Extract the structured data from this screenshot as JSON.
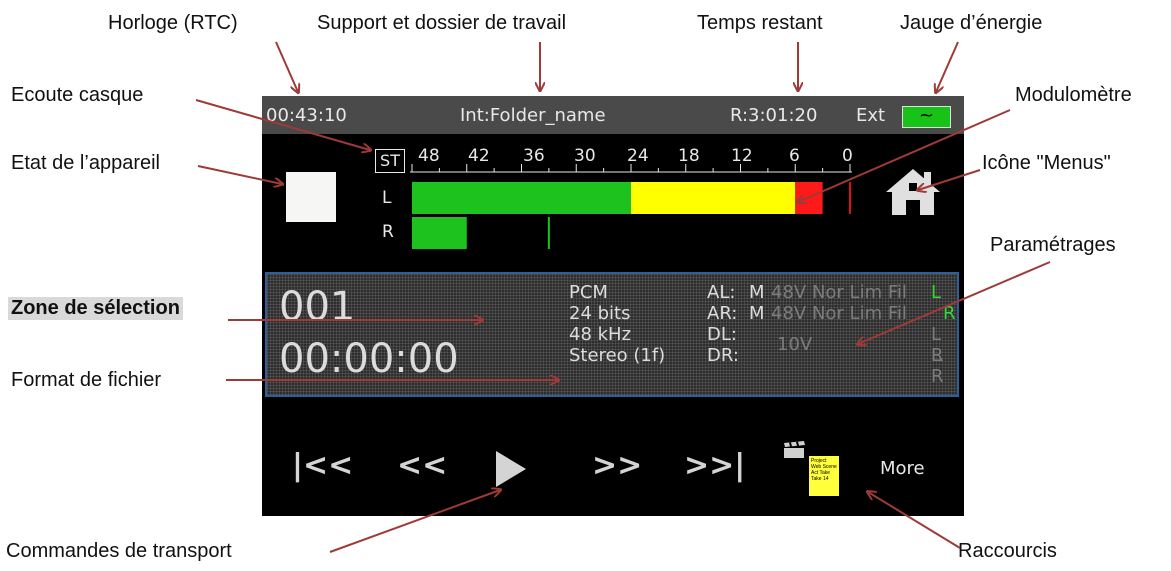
{
  "annotations": {
    "horloge": "Horloge (RTC)",
    "support": "Support et dossier de travail",
    "temps_restant": "Temps restant",
    "jauge": "Jauge d’énergie",
    "ecoute": "Ecoute casque",
    "modulometre": "Modulomètre",
    "etat": "Etat de l’appareil",
    "icone_menus": "Icône \"Menus\"",
    "parametrages": "Paramétrages",
    "zone_selection": "Zone de sélection",
    "format_fichier": "Format de fichier",
    "commandes": "Commandes de transport",
    "raccourcis": "Raccourcis"
  },
  "statusbar": {
    "clock": "00:43:10",
    "folder": "Int:Folder_name",
    "remaining": "R:3:01:20",
    "power_source": "Ext",
    "battery_symbol": "~"
  },
  "meter": {
    "headphone_label": "ST",
    "scale": [
      "48",
      "42",
      "36",
      "30",
      "24",
      "18",
      "12",
      "6",
      "0"
    ],
    "channels": [
      {
        "label": "L",
        "level_db": -3,
        "peak_db": 0,
        "green_until_db": -24,
        "yellow_until_db": -6
      },
      {
        "label": "R",
        "level_db": -42,
        "peak_db": -33
      }
    ],
    "colors": {
      "green": "#1ec21e",
      "yellow": "#ffff00",
      "red": "#ff1a1a"
    }
  },
  "selection": {
    "take": "001",
    "timecode": "00:00:00",
    "format": [
      "PCM",
      "24 bits",
      "48 kHz",
      "Stereo (1f)"
    ],
    "params": [
      {
        "label": "AL:",
        "value": "M",
        "faint": "48V Nor Lim Fil",
        "side": "L"
      },
      {
        "label": "AR:",
        "value": "M",
        "faint": "48V Nor Lim Fil",
        "side": "R"
      },
      {
        "label": "DL:",
        "value": "",
        "faint": "10V",
        "side": "L R"
      },
      {
        "label": "DR:",
        "value": "",
        "faint": "",
        "side": "L R"
      }
    ]
  },
  "transport": {
    "prev": "|<<",
    "rewind": "<<",
    "forward": ">>",
    "next": ">>|"
  },
  "shortcuts": {
    "note_text": "Project Web Scene Act Take Take 14",
    "more": "More"
  }
}
